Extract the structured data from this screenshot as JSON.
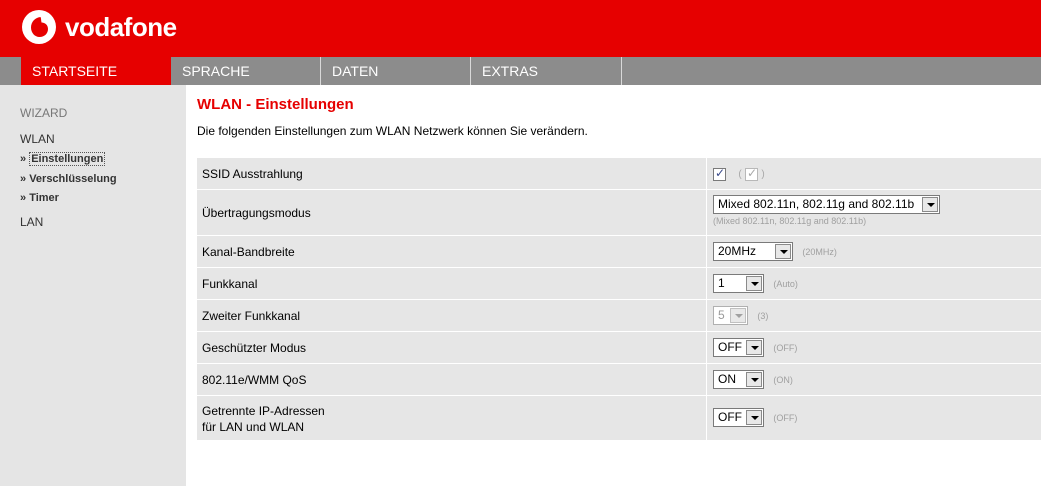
{
  "brand": {
    "name": "vodafone",
    "color": "#e60000"
  },
  "nav": {
    "tabs": [
      {
        "label": "STARTSEITE",
        "active": true
      },
      {
        "label": "SPRACHE",
        "active": false
      },
      {
        "label": "DATEN",
        "active": false
      },
      {
        "label": "EXTRAS",
        "active": false
      }
    ]
  },
  "sidebar": {
    "wizard": "WIZARD",
    "wlan": "WLAN",
    "items": [
      {
        "label": "Einstellungen",
        "current": true
      },
      {
        "label": "Verschlüsselung",
        "current": false
      },
      {
        "label": "Timer",
        "current": false
      }
    ],
    "lan": "LAN"
  },
  "main": {
    "title": "WLAN - Einstellungen",
    "description": "Die folgenden Einstellungen zum WLAN Netzwerk können Sie verändern."
  },
  "settings": {
    "ssid": {
      "label": "SSID Ausstrahlung",
      "checked": true,
      "default_checked": true
    },
    "mode": {
      "label": "Übertragungsmodus",
      "value": "Mixed 802.11n, 802.11g and 802.11b",
      "default": "(Mixed 802.11n, 802.11g and 802.11b)"
    },
    "bandwidth": {
      "label": "Kanal-Bandbreite",
      "value": "20MHz",
      "default": "(20MHz)"
    },
    "channel": {
      "label": "Funkkanal",
      "value": "1",
      "default": "(Auto)"
    },
    "second_channel": {
      "label": "Zweiter Funkkanal",
      "value": "5",
      "default": "(3)"
    },
    "protected": {
      "label": "Geschützter Modus",
      "value": "OFF",
      "default": "(OFF)"
    },
    "wmm": {
      "label": "802.11e/WMM QoS",
      "value": "ON",
      "default": "(ON)"
    },
    "separate_ip": {
      "label_line1": "Getrennte IP-Adressen",
      "label_line2": "für LAN und WLAN",
      "value": "OFF",
      "default": "(OFF)"
    }
  }
}
